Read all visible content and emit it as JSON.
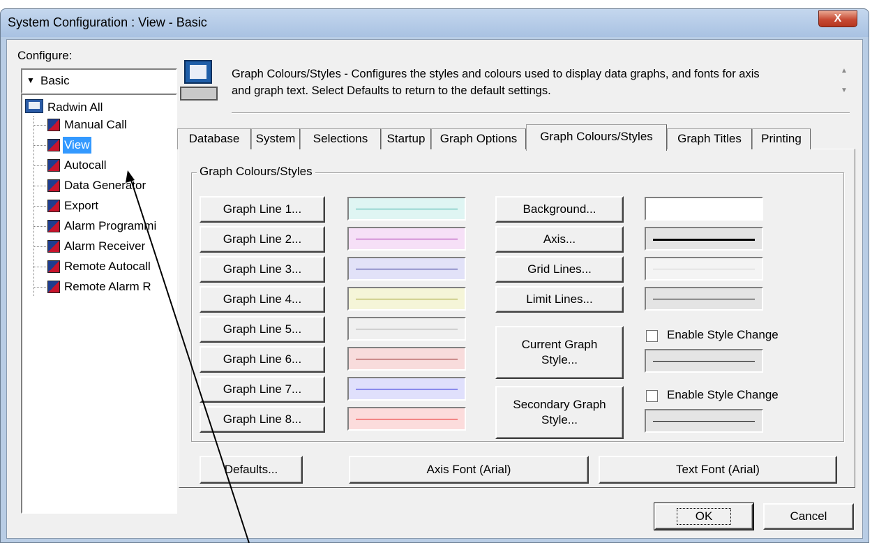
{
  "window": {
    "title": "System Configuration : View - Basic",
    "close_glyph": "X"
  },
  "sidebar": {
    "configure_label": "Configure:",
    "dropdown": {
      "selected": "Basic",
      "arrow_icon": "triangle-down-icon"
    },
    "tree": {
      "root": {
        "label": "Radwin All",
        "icon": "computer-icon"
      },
      "items": [
        {
          "label": "Manual Call",
          "icon": "radwin-app-icon",
          "selected": false
        },
        {
          "label": "View",
          "icon": "radwin-app-icon",
          "selected": true
        },
        {
          "label": "Autocall",
          "icon": "radwin-app-icon",
          "selected": false
        },
        {
          "label": "Data Generator",
          "icon": "radwin-app-icon",
          "selected": false
        },
        {
          "label": "Export",
          "icon": "radwin-app-icon",
          "selected": false
        },
        {
          "label": "Alarm Programmi",
          "icon": "radwin-app-icon",
          "selected": false
        },
        {
          "label": "Alarm Receiver",
          "icon": "radwin-app-icon",
          "selected": false
        },
        {
          "label": "Remote Autocall",
          "icon": "radwin-app-icon",
          "selected": false
        },
        {
          "label": "Remote Alarm R",
          "icon": "radwin-app-icon",
          "selected": false
        }
      ]
    }
  },
  "header": {
    "description_line1": "Graph Colours/Styles - Configures the styles and colours used to display data graphs, and fonts for axis",
    "description_line2": "and graph text. Select Defaults to return to the default settings."
  },
  "tabs": [
    {
      "label": "Database",
      "active": false
    },
    {
      "label": "System",
      "active": false
    },
    {
      "label": "Selections",
      "active": false
    },
    {
      "label": "Startup",
      "active": false
    },
    {
      "label": "Graph Options",
      "active": false
    },
    {
      "label": "Graph Colours/Styles",
      "active": true
    },
    {
      "label": "Graph Titles",
      "active": false
    },
    {
      "label": "Printing",
      "active": false
    }
  ],
  "group": {
    "title": "Graph Colours/Styles",
    "graph_lines": [
      {
        "label": "Graph Line 1...",
        "color": "#2fa9a0",
        "bg": "#dff5f3"
      },
      {
        "label": "Graph Line 2...",
        "color": "#a020a8",
        "bg": "#f6e0f7"
      },
      {
        "label": "Graph Line 3...",
        "color": "#20208c",
        "bg": "#e2e2f8"
      },
      {
        "label": "Graph Line 4...",
        "color": "#9a9a20",
        "bg": "#f5f5d8"
      },
      {
        "label": "Graph Line 5...",
        "color": "#a0a0a0",
        "bg": "#f0f0f0"
      },
      {
        "label": "Graph Line 6...",
        "color": "#8c1818",
        "bg": "#f8dcdc"
      },
      {
        "label": "Graph Line 7...",
        "color": "#1818d8",
        "bg": "#e0e0fc"
      },
      {
        "label": "Graph Line 8...",
        "color": "#e81818",
        "bg": "#fcdcdc"
      }
    ],
    "style_buttons": [
      {
        "label": "Background...",
        "line_color": "",
        "line_width": 0,
        "bg": "#ffffff"
      },
      {
        "label": "Axis...",
        "line_color": "#000000",
        "line_width": 3,
        "bg": "#e4e4e4"
      },
      {
        "label": "Grid Lines...",
        "line_color": "#cfcfcf",
        "line_width": 1,
        "bg": "#f4f4f4"
      },
      {
        "label": "Limit Lines...",
        "line_color": "#000000",
        "line_width": 1,
        "bg": "#e4e4e4"
      }
    ],
    "current_graph_style": {
      "line1": "Current Graph",
      "line2": "Style..."
    },
    "secondary_graph_style": {
      "line1": "Secondary Graph",
      "line2": "Style..."
    },
    "enable_style_change_1": {
      "label": "Enable Style Change",
      "checked": false
    },
    "enable_style_change_2": {
      "label": "Enable Style Change",
      "checked": false
    }
  },
  "bottom_buttons": {
    "defaults": "Defaults...",
    "axis_font": "Axis Font (Arial)",
    "text_font": "Text Font (Arial)"
  },
  "dialog_buttons": {
    "ok": "OK",
    "cancel": "Cancel"
  }
}
